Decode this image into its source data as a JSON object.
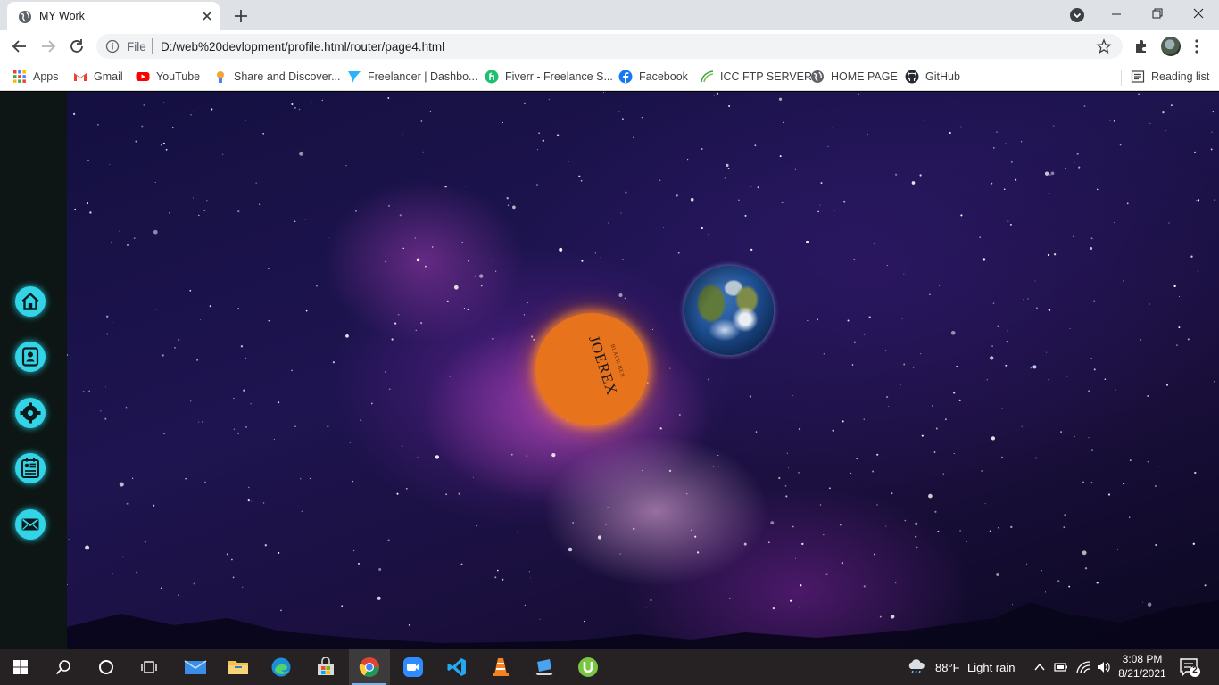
{
  "browser": {
    "tab_title": "MY Work",
    "tab_favicon": "globe-icon",
    "scheme_label": "File",
    "url": "D:/web%20devlopment/profile.html/router/page4.html"
  },
  "bookmarks": {
    "apps": "Apps",
    "items": [
      {
        "label": "Gmail",
        "icon": "gmail-icon"
      },
      {
        "label": "YouTube",
        "icon": "youtube-icon"
      },
      {
        "label": "Share and Discover...",
        "icon": "share-discover-icon"
      },
      {
        "label": "Freelancer | Dashbo...",
        "icon": "freelancer-icon"
      },
      {
        "label": "Fiverr - Freelance S...",
        "icon": "fiverr-icon"
      },
      {
        "label": "Facebook",
        "icon": "facebook-icon"
      },
      {
        "label": "ICC FTP SERVER",
        "icon": "icc-icon"
      },
      {
        "label": "HOME PAGE",
        "icon": "globe-icon"
      },
      {
        "label": "GitHub",
        "icon": "github-icon"
      }
    ],
    "reading_list": "Reading list"
  },
  "page": {
    "side_nav": [
      {
        "name": "home",
        "icon": "home-icon"
      },
      {
        "name": "profile",
        "icon": "profile-card-icon"
      },
      {
        "name": "settings",
        "icon": "gear-icon"
      },
      {
        "name": "resume",
        "icon": "id-card-icon"
      },
      {
        "name": "contact",
        "icon": "mail-icon"
      }
    ],
    "sun": {
      "name": "JOEREX",
      "subtitle": "BLACK HEX"
    },
    "accent_color": "#32d4e6",
    "sun_color": "#e8731d"
  },
  "taskbar": {
    "apps": [
      "windows-start-icon",
      "search-icon",
      "cortana-icon",
      "task-view-icon",
      "mail-app-icon",
      "file-explorer-icon",
      "edge-icon",
      "store-icon",
      "chrome-icon",
      "zoom-icon",
      "vscode-icon",
      "vlc-icon",
      "app-icon",
      "utorrent-icon"
    ],
    "weather_temp": "88°F",
    "weather_text": "Light rain",
    "time": "3:08 PM",
    "date": "8/21/2021",
    "notification_count": "2"
  }
}
